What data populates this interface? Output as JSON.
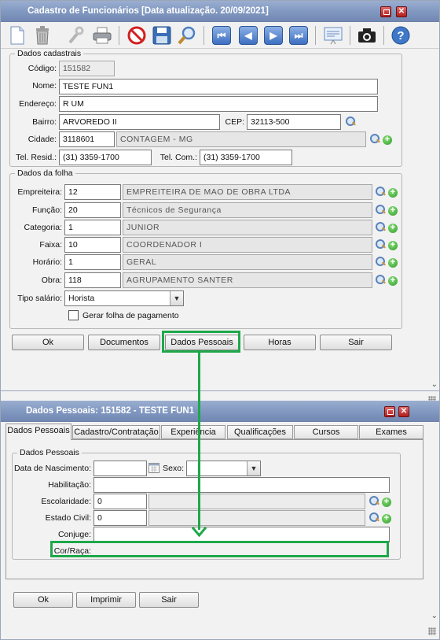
{
  "window1": {
    "title": "Cadastro de Funcionários [Data atualização. 20/09/2021]",
    "dados_cadastrais": {
      "legend": "Dados cadastrais",
      "codigo_label": "Código:",
      "codigo": "151582",
      "nome_label": "Nome:",
      "nome": "TESTE FUN1",
      "endereco_label": "Endereço:",
      "endereco": "R UM",
      "bairro_label": "Bairro:",
      "bairro": "ARVOREDO II",
      "cep_label": "CEP:",
      "cep": "32113-500",
      "cidade_label": "Cidade:",
      "cidade_codigo": "3118601",
      "cidade_nome": "CONTAGEM - MG",
      "tel_resid_label": "Tel. Resid.:",
      "tel_resid": "(31) 3359-1700",
      "tel_com_label": "Tel. Com.:",
      "tel_com": "(31) 3359-1700"
    },
    "dados_folha": {
      "legend": "Dados da folha",
      "empreiteira_label": "Empreiteira:",
      "empreiteira_codigo": "12",
      "empreiteira_nome": "EMPREITEIRA DE MAO DE OBRA LTDA",
      "funcao_label": "Função:",
      "funcao_codigo": "20",
      "funcao_nome": "Técnicos de Segurança",
      "categoria_label": "Categoria:",
      "categoria_codigo": "1",
      "categoria_nome": "JUNIOR",
      "faixa_label": "Faixa:",
      "faixa_codigo": "10",
      "faixa_nome": "COORDENADOR I",
      "horario_label": "Horário:",
      "horario_codigo": "1",
      "horario_nome": "GERAL",
      "obra_label": "Obra:",
      "obra_codigo": "118",
      "obra_nome": "AGRUPAMENTO SANTER",
      "tipo_salario_label": "Tipo salário:",
      "tipo_salario": "Horista",
      "gerar_folha_label": "Gerar folha de pagamento",
      "gerar_folha_checked": false
    },
    "buttons": {
      "ok": "Ok",
      "documentos": "Documentos",
      "dados_pessoais": "Dados Pessoais",
      "horas": "Horas",
      "sair": "Sair"
    }
  },
  "window2": {
    "title": "Dados Pessoais: 151582 - TESTE FUN1",
    "tabs": [
      "Dados Pessoais",
      "Cadastro/Contratação",
      "Experiência",
      "Qualificações",
      "Cursos",
      "Exames"
    ],
    "active_tab": "Dados Pessoais",
    "group_legend": "Dados Pessoais",
    "data_nascimento_label": "Data de Nascimento:",
    "data_nascimento": "",
    "sexo_label": "Sexo:",
    "sexo": "",
    "habilitacao_label": "Habilitação:",
    "habilitacao": "",
    "escolaridade_label": "Escolaridade:",
    "escolaridade_codigo": "0",
    "escolaridade_nome": "",
    "estado_civil_label": "Estado Civil:",
    "estado_civil_codigo": "0",
    "estado_civil_nome": "",
    "conjuge_label": "Conjuge:",
    "conjuge": "",
    "cor_raca_label": "Cor/Raça:",
    "cor_raca": "",
    "buttons": {
      "ok": "Ok",
      "imprimir": "Imprimir",
      "sair": "Sair"
    }
  },
  "highlight_color": "#1ea84a",
  "icons": [
    "new-document-icon",
    "trash-icon",
    "tools-icon",
    "printer-icon",
    "cancel-icon",
    "save-icon",
    "search-icon",
    "first-record-icon",
    "previous-record-icon",
    "next-record-icon",
    "last-record-icon",
    "report-icon",
    "camera-icon",
    "help-icon"
  ]
}
